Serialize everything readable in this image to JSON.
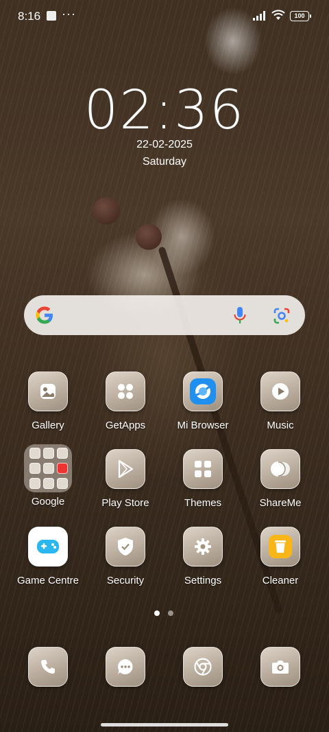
{
  "status_bar": {
    "time": "8:16",
    "more": "···",
    "battery": "100"
  },
  "lock_widget": {
    "clock": "02:36",
    "date": "22-02-2025",
    "day": "Saturday"
  },
  "search_bar": {
    "google_icon": "google-g-icon",
    "mic_icon": "mic-icon",
    "lens_icon": "google-lens-icon"
  },
  "apps": [
    {
      "label": "Gallery",
      "icon": "gallery-icon"
    },
    {
      "label": "GetApps",
      "icon": "getapps-icon"
    },
    {
      "label": "Mi Browser",
      "icon": "mi-browser-icon"
    },
    {
      "label": "Music",
      "icon": "music-icon"
    },
    {
      "label": "Google",
      "icon": "folder-icon"
    },
    {
      "label": "Play Store",
      "icon": "play-store-icon"
    },
    {
      "label": "Themes",
      "icon": "themes-icon"
    },
    {
      "label": "ShareMe",
      "icon": "shareme-icon"
    },
    {
      "label": "Game Centre",
      "icon": "game-centre-icon"
    },
    {
      "label": "Security",
      "icon": "security-shield-icon"
    },
    {
      "label": "Settings",
      "icon": "settings-gear-icon"
    },
    {
      "label": "Cleaner",
      "icon": "cleaner-bin-icon"
    }
  ],
  "pager": {
    "pages": 2,
    "current": 1
  },
  "dock": [
    {
      "icon": "phone-icon"
    },
    {
      "icon": "messages-icon"
    },
    {
      "icon": "chrome-icon"
    },
    {
      "icon": "camera-icon"
    }
  ],
  "colors": {
    "browser_blue": "#1f8ff0",
    "cleaner_yellow": "#f8b619",
    "game_cyan": "#2ab6ee"
  }
}
